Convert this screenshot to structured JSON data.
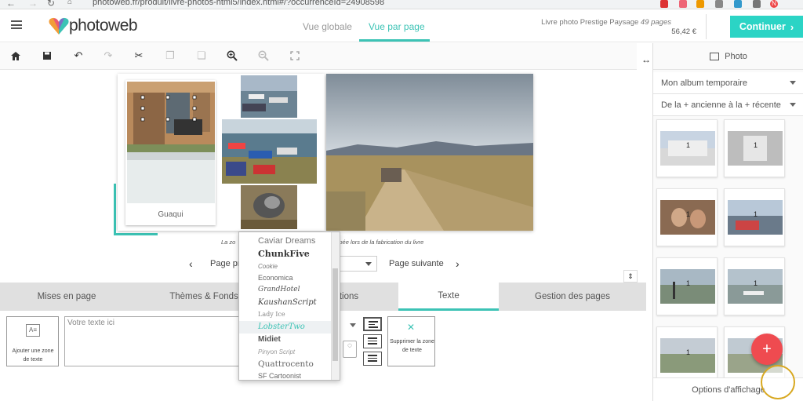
{
  "browser": {
    "url": "photoweb.fr/produit/livre-photos-html5/index.html#/?occurrenceId=24908598",
    "profile_initial": "N"
  },
  "header": {
    "logo_text": "photoweb",
    "tabs": [
      {
        "label": "Vue globale",
        "active": false
      },
      {
        "label": "Vue par page",
        "active": true
      }
    ],
    "product_name": "Livre photo Prestige Paysage",
    "product_pages": "49 pages",
    "price": "56,42 €",
    "continue_label": "Continuer",
    "accent_color": "#2bd4c5"
  },
  "toolbar": {
    "icons": [
      "home-icon",
      "save-icon",
      "undo-icon",
      "redo-icon",
      "cut-icon",
      "copy-icon",
      "paste-icon",
      "zoom-in-icon",
      "zoom-out-icon",
      "fullscreen-icon"
    ]
  },
  "canvas": {
    "caption": "Guaqui",
    "note_start": "La zo",
    "note_end": "pée lors de la fabrication du livre",
    "pager": {
      "prev_label": "Page pr",
      "next_label": "Page suivante"
    }
  },
  "bottom_tabs": [
    {
      "label": "Mises en page",
      "active": false
    },
    {
      "label": "Thèmes & Fonds",
      "active": false
    },
    {
      "label": "tions",
      "active": false
    },
    {
      "label": "Texte",
      "active": true
    },
    {
      "label": "Gestion des pages",
      "active": false
    }
  ],
  "text_panel": {
    "add_zone_label": "Ajouter une zone de texte",
    "text_placeholder": "Votre texte ici",
    "delete_zone_label": "Supprimer la zone de texte"
  },
  "font_dropdown": {
    "items": [
      "Caviar Dreams",
      "ChunkFive",
      "Cookie",
      "Economica",
      "GrandHotel",
      "KaushanScript",
      "Lady Ice",
      "LobsterTwo",
      "Midiet",
      "Pinyon Script",
      "Quattrocento",
      "SF Cartoonist"
    ],
    "highlighted": "LobsterTwo"
  },
  "right_panel": {
    "tab_label": "Photo",
    "album_select": "Mon album temporaire",
    "sort_select": "De la + ancienne à la + récente",
    "thumbnails": [
      {
        "count": "1"
      },
      {
        "count": "1"
      },
      {
        "count": "1"
      },
      {
        "count": "1"
      },
      {
        "count": "1"
      },
      {
        "count": "1"
      },
      {
        "count": "1"
      },
      {
        "count": "1"
      }
    ],
    "options_label": "Options d'affichage",
    "fab_label": "+",
    "fab_color": "#ef4b50"
  }
}
